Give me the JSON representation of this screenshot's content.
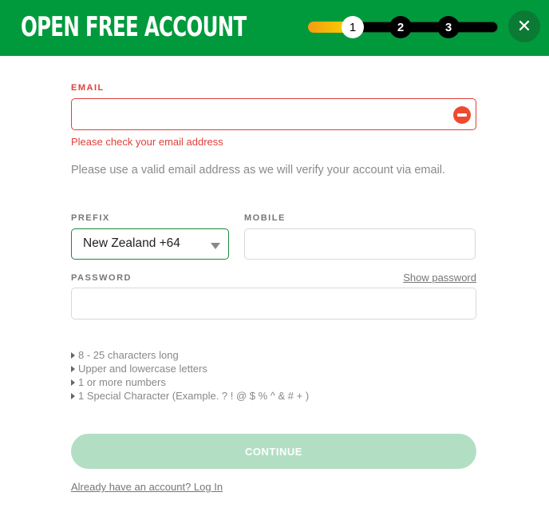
{
  "header": {
    "title": "OPEN FREE ACCOUNT",
    "brand_color": "#009a3c",
    "steps": [
      {
        "label": "1",
        "state": "active"
      },
      {
        "label": "2",
        "state": "upcoming"
      },
      {
        "label": "3",
        "state": "upcoming"
      }
    ],
    "close_icon": "close-icon"
  },
  "form": {
    "email": {
      "label": "EMAIL",
      "value": "",
      "state": "error",
      "error_icon": "error-minus-icon",
      "error_message": "Please check your email address",
      "help_text": "Please use a valid email address as we will verify your account via email."
    },
    "prefix": {
      "label": "PREFIX",
      "selected": "New Zealand +64"
    },
    "mobile": {
      "label": "MOBILE",
      "value": ""
    },
    "password": {
      "label": "PASSWORD",
      "value": "",
      "show_password_label": "Show password",
      "rules": [
        "8 - 25 characters long",
        "Upper and lowercase letters",
        "1 or more numbers",
        "1 Special Character (Example. ? ! @ $ % ^ & # + )"
      ]
    },
    "continue_label": "CONTINUE",
    "login_link": "Already have an account? Log In"
  }
}
